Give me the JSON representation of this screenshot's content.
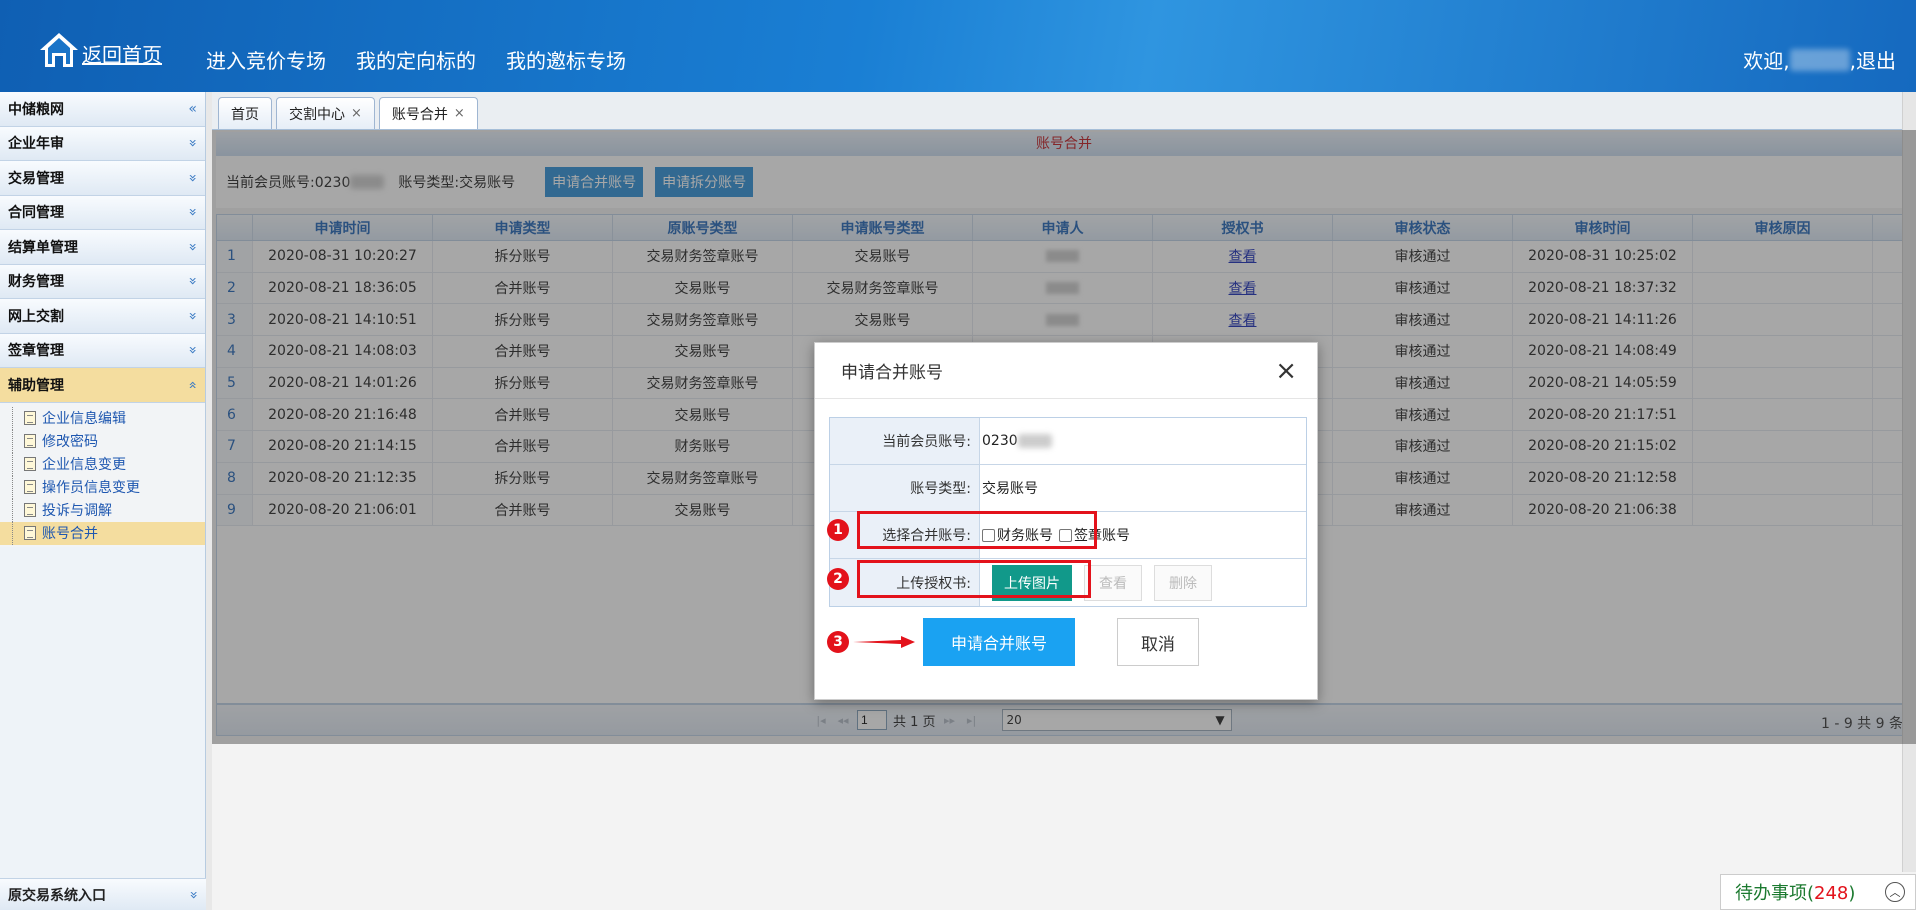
{
  "header": {
    "home_label": "返回首页",
    "nav": [
      "进入竞价专场",
      "我的定向标的",
      "我的邀标专场"
    ],
    "welcome": "欢迎,",
    "user_blurred": "███",
    "logout": ",退出"
  },
  "sidebar": {
    "menus": [
      {
        "label": "中储粮网",
        "chev": "«"
      },
      {
        "label": "企业年审",
        "chev": "»"
      },
      {
        "label": "交易管理",
        "chev": "»"
      },
      {
        "label": "合同管理",
        "chev": "»"
      },
      {
        "label": "结算单管理",
        "chev": "»"
      },
      {
        "label": "财务管理",
        "chev": "»"
      },
      {
        "label": "网上交割",
        "chev": "»"
      },
      {
        "label": "签章管理",
        "chev": "»"
      },
      {
        "label": "辅助管理",
        "chev": "«"
      }
    ],
    "sub_items": [
      "企业信息编辑",
      "修改密码",
      "企业信息变更",
      "操作员信息变更",
      "投诉与调解",
      "账号合并"
    ],
    "bottom": {
      "label": "原交易系统入口",
      "chev": "»"
    }
  },
  "tabs": [
    {
      "label": "首页",
      "close": ""
    },
    {
      "label": "交割中心",
      "close": "×"
    },
    {
      "label": "账号合并",
      "close": "×"
    }
  ],
  "panel": {
    "title": "账号合并",
    "member_label": "当前会员账号:0230",
    "member_blur": "████",
    "type_label": "账号类型:交易账号",
    "btn_merge": "申请合并账号",
    "btn_split": "申请拆分账号"
  },
  "table": {
    "headers": [
      "",
      "申请时间",
      "申请类型",
      "原账号类型",
      "申请账号类型",
      "申请人",
      "授权书",
      "审核状态",
      "审核时间",
      "审核原因"
    ],
    "rows": [
      {
        "n": "1",
        "time": "2020-08-31 10:20:27",
        "type": "拆分账号",
        "orig": "交易财务签章账号",
        "apply": "交易账号",
        "person": "███",
        "auth": "查看",
        "status": "审核通过",
        "audit": "2020-08-31 10:25:02",
        "reason": ""
      },
      {
        "n": "2",
        "time": "2020-08-21 18:36:05",
        "type": "合并账号",
        "orig": "交易账号",
        "apply": "交易财务签章账号",
        "person": "███",
        "auth": "查看",
        "status": "审核通过",
        "audit": "2020-08-21 18:37:32",
        "reason": ""
      },
      {
        "n": "3",
        "time": "2020-08-21 14:10:51",
        "type": "拆分账号",
        "orig": "交易财务签章账号",
        "apply": "交易账号",
        "person": "███",
        "auth": "查看",
        "status": "审核通过",
        "audit": "2020-08-21 14:11:26",
        "reason": ""
      },
      {
        "n": "4",
        "time": "2020-08-21 14:08:03",
        "type": "合并账号",
        "orig": "交易账号",
        "apply": "",
        "person": "",
        "auth": "",
        "status": "审核通过",
        "audit": "2020-08-21 14:08:49",
        "reason": ""
      },
      {
        "n": "5",
        "time": "2020-08-21 14:01:26",
        "type": "拆分账号",
        "orig": "交易财务签章账号",
        "apply": "",
        "person": "",
        "auth": "",
        "status": "审核通过",
        "audit": "2020-08-21 14:05:59",
        "reason": ""
      },
      {
        "n": "6",
        "time": "2020-08-20 21:16:48",
        "type": "合并账号",
        "orig": "交易账号",
        "apply": "",
        "person": "",
        "auth": "",
        "status": "审核通过",
        "audit": "2020-08-20 21:17:51",
        "reason": ""
      },
      {
        "n": "7",
        "time": "2020-08-20 21:14:15",
        "type": "合并账号",
        "orig": "财务账号",
        "apply": "",
        "person": "",
        "auth": "",
        "status": "审核通过",
        "audit": "2020-08-20 21:15:02",
        "reason": ""
      },
      {
        "n": "8",
        "time": "2020-08-20 21:12:35",
        "type": "拆分账号",
        "orig": "交易财务签章账号",
        "apply": "",
        "person": "",
        "auth": "",
        "status": "审核通过",
        "audit": "2020-08-20 21:12:58",
        "reason": ""
      },
      {
        "n": "9",
        "time": "2020-08-20 21:06:01",
        "type": "合并账号",
        "orig": "交易账号",
        "apply": "",
        "person": "",
        "auth": "",
        "status": "审核通过",
        "audit": "2020-08-20 21:06:38",
        "reason": ""
      }
    ]
  },
  "pager": {
    "page_value": "1",
    "total_pages": "共  1 页",
    "page_size": "20",
    "info": "1 - 9   共 9 条"
  },
  "modal": {
    "title": "申请合并账号",
    "close": "×",
    "member_label": "当前会员账号:",
    "member_value": "0230",
    "member_blur": "████",
    "type_label": "账号类型:",
    "type_value": "交易账号",
    "select_label": "选择合并账号:",
    "opt_finance": "财务账号",
    "opt_seal": "签章账号",
    "upload_label": "上传授权书:",
    "upload_btn": "上传图片",
    "view_btn": "查看",
    "delete_btn": "删除",
    "submit": "申请合并账号",
    "cancel": "取消",
    "markers": [
      "1",
      "2",
      "3"
    ]
  },
  "todo": {
    "label": "待办事项",
    "open": "(",
    "count": "248",
    "close": ")"
  },
  "colors": {
    "header": "#1a7fd4",
    "accent": "#1aa2f2",
    "upload": "#11998a",
    "annotation": "#e3121b"
  }
}
